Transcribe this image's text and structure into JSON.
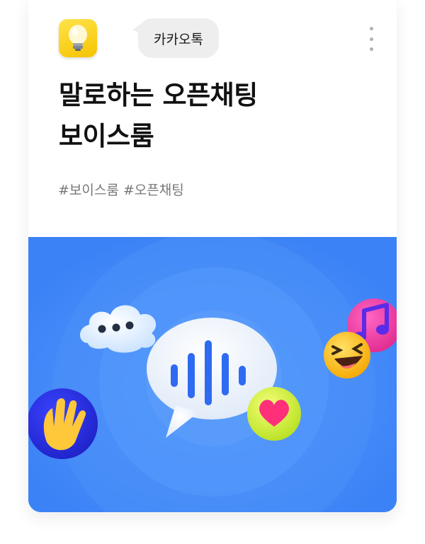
{
  "post": {
    "source_name": "카카오톡",
    "title_line1": "말로하는 오픈채팅",
    "title_line2": "보이스룸",
    "hashtags": [
      "#보이스룸",
      "#오픈채팅"
    ]
  },
  "icons": {
    "app_icon": "lightbulb-icon",
    "more": "more-vertical-icon",
    "banner": [
      "voice-chat-bubble-icon",
      "typing-cloud-icon",
      "music-note-icon",
      "laughing-emoji-icon",
      "heart-icon",
      "waving-hand-icon"
    ]
  },
  "colors": {
    "banner_background": "#3b82f6",
    "app_icon_yellow": "#f5c400",
    "voice_bars": "#2f6bf0"
  }
}
